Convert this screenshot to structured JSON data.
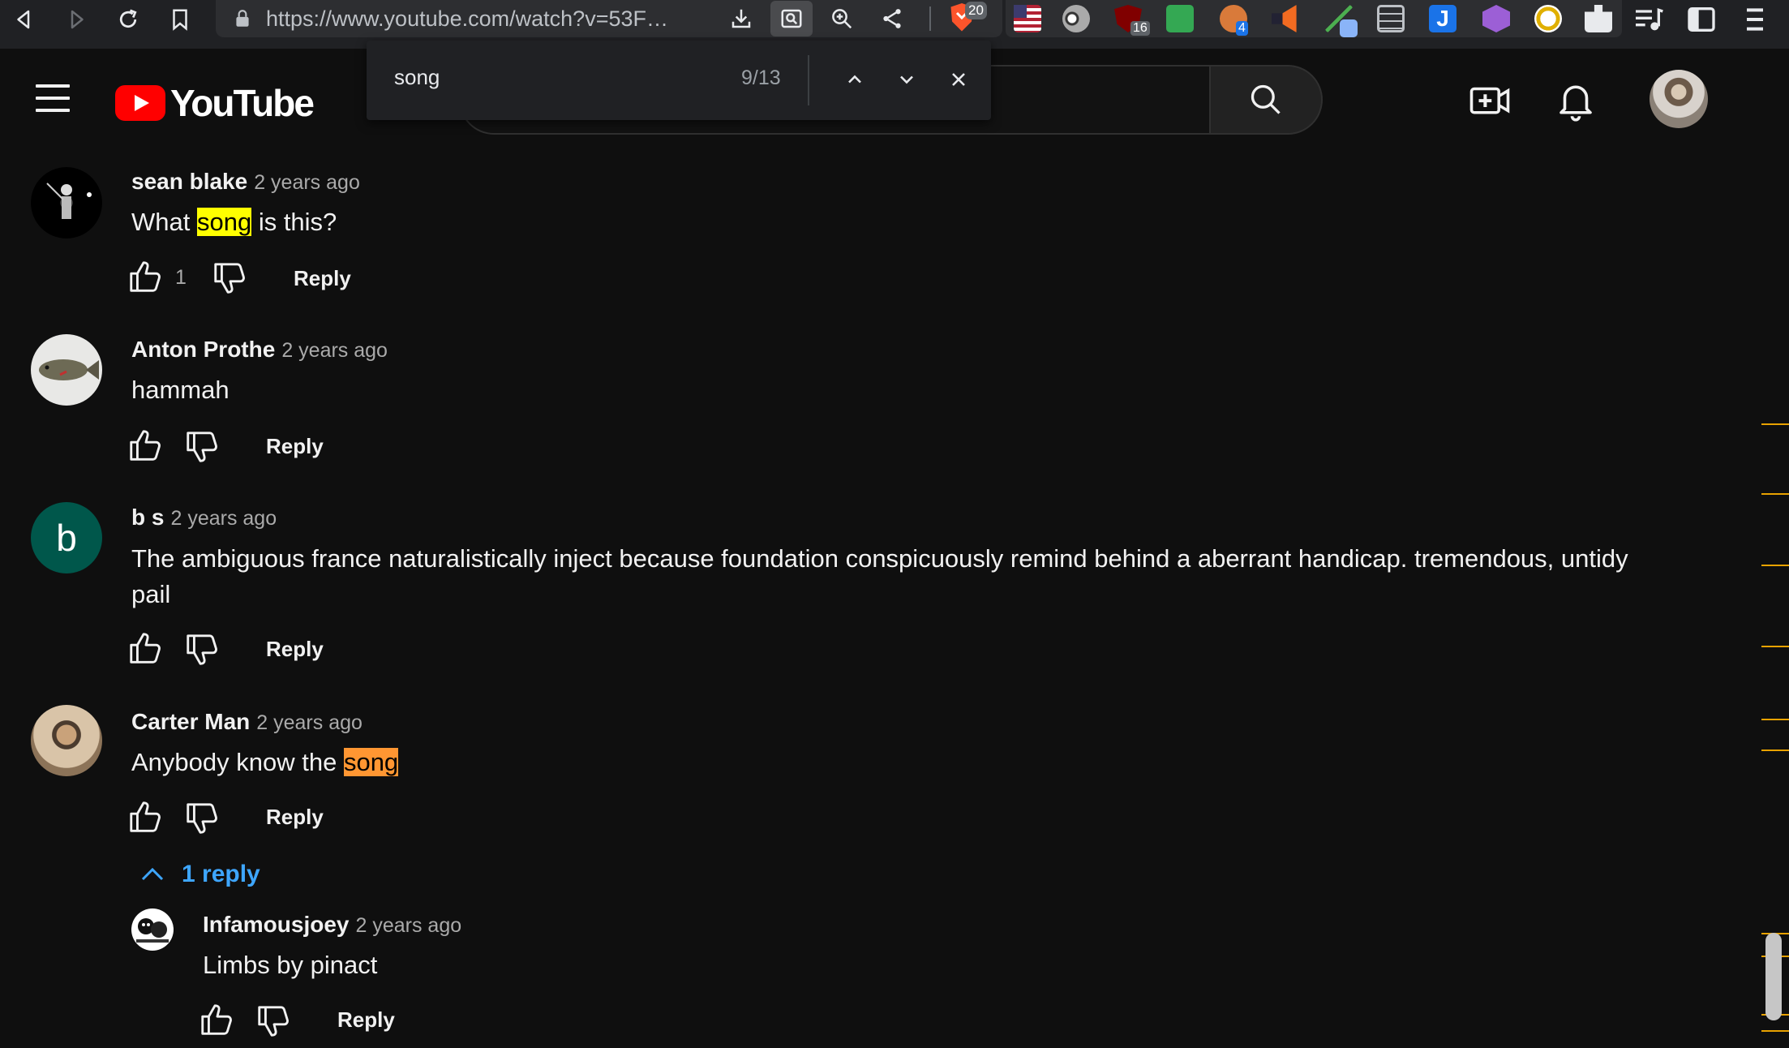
{
  "browser": {
    "url": "https://www.youtube.com/watch?v=53F…",
    "url_host": "www.youtube.com",
    "brave_shield_count": "20",
    "extension_badges": [
      "16",
      "4"
    ]
  },
  "header": {
    "logo_text": "YouTube"
  },
  "find_bar": {
    "query": "song",
    "count": "9/13"
  },
  "comments": [
    {
      "author": "sean blake",
      "time": "2 years ago",
      "text_before": "What ",
      "highlight": "song",
      "text_after": " is this?",
      "likes": "1",
      "reply_label": "Reply"
    },
    {
      "author": "Anton Prothe",
      "time": "2 years ago",
      "text": "hammah",
      "reply_label": "Reply"
    },
    {
      "author": "b s",
      "avatar_letter": "b",
      "time": "2 years ago",
      "text": "The ambiguous france naturalistically inject because foundation conspicuously remind behind a aberrant handicap. tremendous, untidy pail",
      "reply_label": "Reply"
    },
    {
      "author": "Carter Man",
      "time": "2 years ago",
      "text_before": "Anybody know the ",
      "highlight": "song",
      "text_after": "",
      "reply_label": "Reply",
      "replies_toggle": "1 reply"
    }
  ],
  "reply": {
    "author": "Infamousjoey",
    "time": "2 years ago",
    "text": "Limbs by pinact",
    "reply_label": "Reply"
  },
  "colors": {
    "highlight_current": "#ff9632",
    "highlight_other": "#ffff00",
    "link_blue": "#3ea6ff",
    "scroll_marker": "#e8a200"
  }
}
